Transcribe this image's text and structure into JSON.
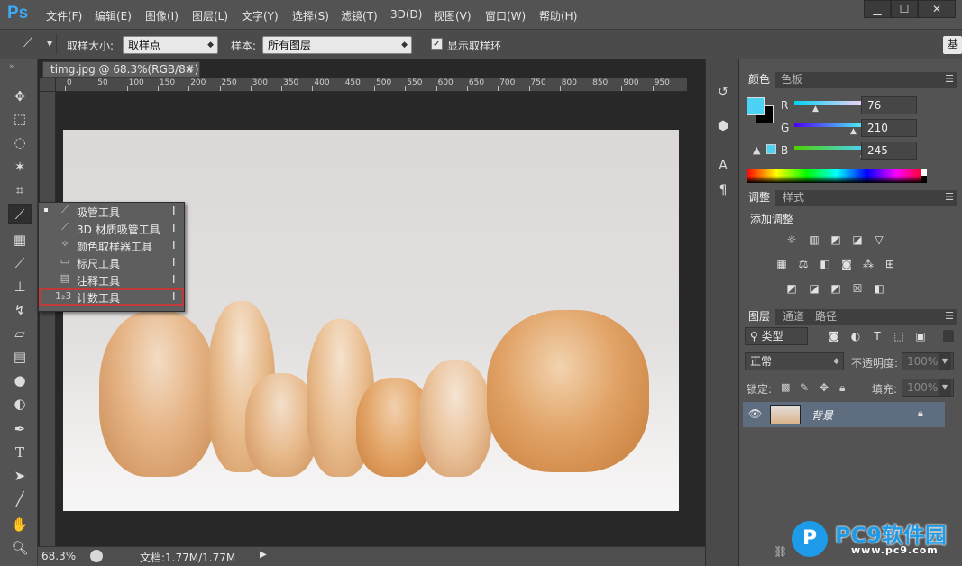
{
  "app": {
    "logo": "Ps"
  },
  "menu": [
    "文件(F)",
    "编辑(E)",
    "图像(I)",
    "图层(L)",
    "文字(Y)",
    "选择(S)",
    "滤镜(T)",
    "3D(D)",
    "视图(V)",
    "窗口(W)",
    "帮助(H)"
  ],
  "options": {
    "sample_size_label": "取样大小:",
    "sample_size_value": "取样点",
    "sample_label": "样本:",
    "sample_value": "所有图层",
    "show_ring_label": "显示取样环",
    "show_ring_checked": true
  },
  "document": {
    "tab_title": "timg.jpg @ 68.3%(RGB/8#)",
    "close": "×",
    "ruler_ticks": [
      "0",
      "50",
      "100",
      "150",
      "200",
      "250",
      "300",
      "350",
      "400",
      "450",
      "500",
      "550",
      "600",
      "650",
      "700",
      "750",
      "800",
      "850",
      "900",
      "950"
    ]
  },
  "status": {
    "zoom": "68.3%",
    "doc_info": "文档:1.77M/1.77M"
  },
  "flyout": {
    "items": [
      {
        "icon": "eyedropper-icon",
        "label": "吸管工具",
        "key": "I",
        "selected": true
      },
      {
        "icon": "3d-material-eyedropper-icon",
        "label": "3D 材质吸管工具",
        "key": "I",
        "selected": false
      },
      {
        "icon": "color-sampler-icon",
        "label": "颜色取样器工具",
        "key": "I",
        "selected": false
      },
      {
        "icon": "ruler-icon",
        "label": "标尺工具",
        "key": "I",
        "selected": false
      },
      {
        "icon": "note-icon",
        "label": "注释工具",
        "key": "I",
        "selected": false
      },
      {
        "icon": "count-icon",
        "label": "计数工具",
        "key": "I",
        "selected": false
      }
    ],
    "count_icon_glyph": "1₂3"
  },
  "color_panel": {
    "tabs": [
      "颜色",
      "色板"
    ],
    "r_label": "R",
    "g_label": "G",
    "b_label": "B",
    "r": "76",
    "g": "210",
    "b": "245",
    "foreground": "#4cd2f5"
  },
  "adjust_panel": {
    "tabs": [
      "调整",
      "样式"
    ],
    "title": "添加调整"
  },
  "layers_panel": {
    "tabs": [
      "图层",
      "通道",
      "路径"
    ],
    "filter_label": "类型",
    "blend_mode": "正常",
    "opacity_label": "不透明度:",
    "opacity_value": "100%",
    "lock_label": "锁定:",
    "fill_label": "填充:",
    "fill_value": "100%",
    "layers": [
      {
        "name": "背景",
        "visible": true,
        "locked": true
      }
    ]
  },
  "watermark": {
    "brand": "PC9软件园",
    "url": "www.pc9.com"
  },
  "colors": {
    "accent_highlight": "#c0393b",
    "foreground_swatch": "#4cd2f5"
  }
}
